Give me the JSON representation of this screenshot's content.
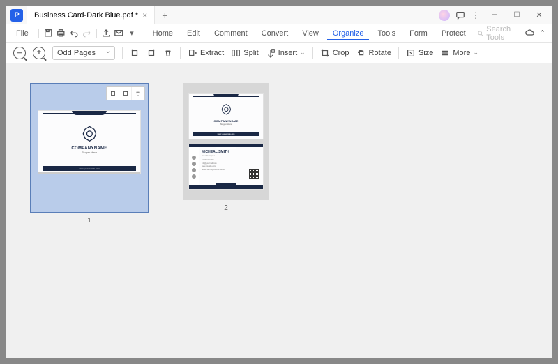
{
  "titlebar": {
    "app_icon_letter": "P",
    "tab_title": "Business Card-Dark Blue.pdf *"
  },
  "menubar": {
    "file": "File",
    "items": [
      "Home",
      "Edit",
      "Comment",
      "Convert",
      "View",
      "Organize",
      "Tools",
      "Form",
      "Protect"
    ],
    "active_index": 5,
    "search_placeholder": "Search Tools"
  },
  "toolbar": {
    "page_filter": "Odd Pages",
    "extract": "Extract",
    "split": "Split",
    "insert": "Insert",
    "crop": "Crop",
    "rotate": "Rotate",
    "size": "Size",
    "more": "More"
  },
  "pages": {
    "page1_label": "1",
    "page2_label": "2"
  },
  "card": {
    "company": "COMPANYNAME",
    "slogan": "Slogan Here",
    "website": "www.yourwebsite.com",
    "name": "MICHEAL SMITH",
    "role": "Your Designer",
    "phone": "+0 000 000 000",
    "email": "info@yourmail.com",
    "web": "www.yoursite.com",
    "addr": "Street 123 City Avenue World"
  }
}
